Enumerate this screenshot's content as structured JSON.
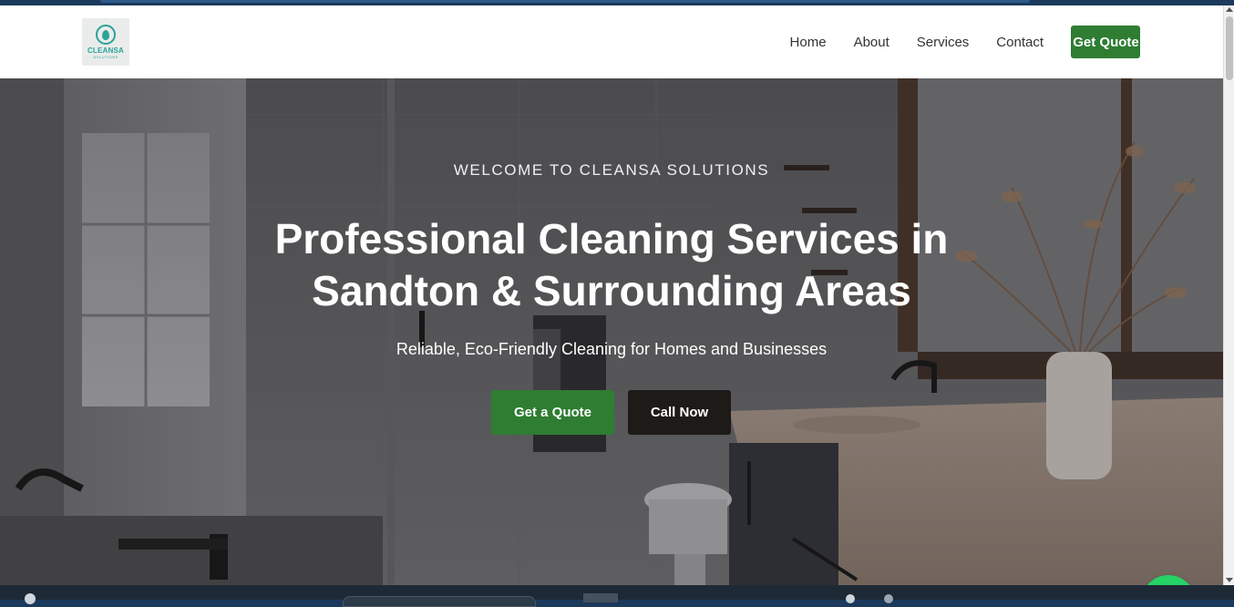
{
  "logo": {
    "name": "CLEANSA",
    "tagline": "SOLUTIONS"
  },
  "nav": {
    "items": [
      {
        "label": "Home"
      },
      {
        "label": "About"
      },
      {
        "label": "Services"
      },
      {
        "label": "Contact"
      }
    ],
    "cta_label": "Get Quote"
  },
  "hero": {
    "eyebrow": "WELCOME TO CLEANSA SOLUTIONS",
    "title_line1": "Professional Cleaning Services in",
    "title_line2": "Sandton & Surrounding Areas",
    "subtitle": "Reliable, Eco-Friendly Cleaning for Homes and Businesses",
    "primary_button": "Get a Quote",
    "secondary_button": "Call Now"
  },
  "floating": {
    "whatsapp_icon": "whatsapp-icon"
  },
  "colors": {
    "brand_green": "#2e7d32",
    "brand_teal": "#2aa39b",
    "dark_button": "#1e1a18",
    "whatsapp_green": "#25d366"
  }
}
